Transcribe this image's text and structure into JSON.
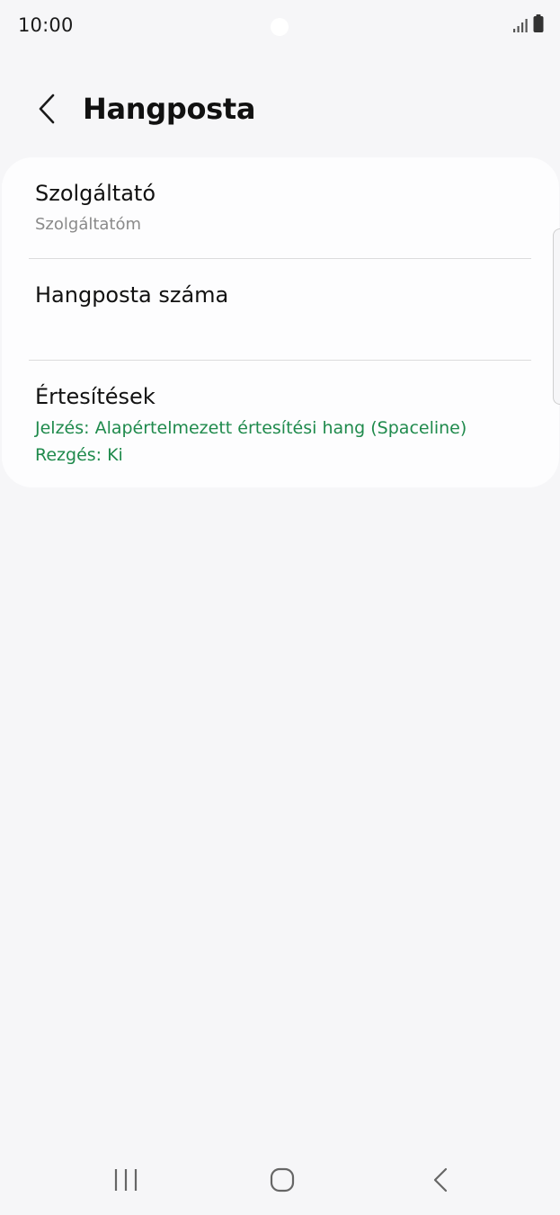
{
  "status_bar": {
    "time": "10:00",
    "icons": [
      "signal-icon",
      "battery-icon"
    ]
  },
  "header": {
    "title": "Hangposta",
    "back_icon": "chevron-left-icon"
  },
  "settings": [
    {
      "title": "Szolgáltató",
      "subtitle": "Szolgáltatóm"
    },
    {
      "title": "Hangposta száma"
    },
    {
      "title": "Értesítések",
      "detail_lines": [
        "Jelzés: Alapértelmezett értesítési hang (Spaceline)",
        "Rezgés: Ki"
      ]
    }
  ],
  "colors": {
    "background": "#f6f6f8",
    "card": "#fdfdfe",
    "accent_green": "#1f8a4c",
    "secondary_text": "#8a8a8a"
  },
  "nav_bar": {
    "icons": [
      "recents-icon",
      "home-icon",
      "back-icon"
    ]
  }
}
